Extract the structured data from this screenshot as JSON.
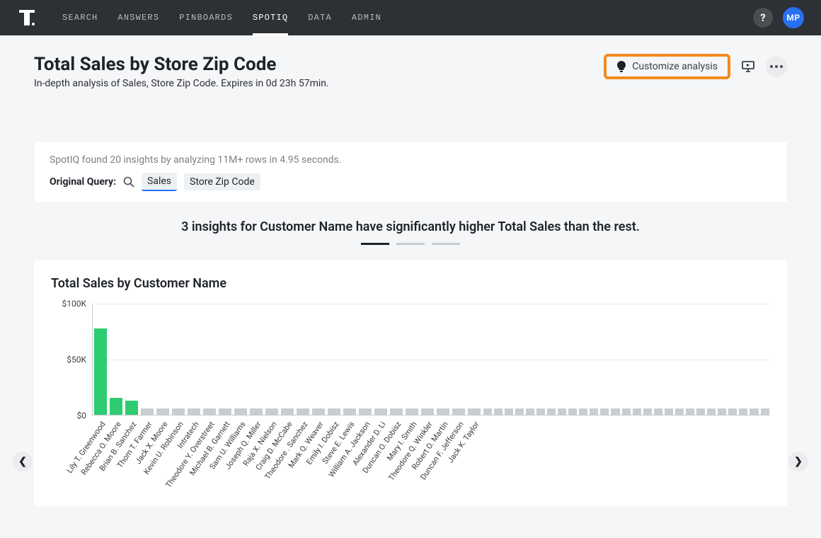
{
  "nav": {
    "items": [
      "SEARCH",
      "ANSWERS",
      "PINBOARDS",
      "SPOTIQ",
      "DATA",
      "ADMIN"
    ],
    "active_index": 3,
    "avatar": "MP",
    "help": "?"
  },
  "header": {
    "title": "Total Sales by Store Zip Code",
    "subtitle": "In-depth analysis of Sales, Store Zip Code. Expires in 0d 23h 57min.",
    "customize_label": "Customize analysis"
  },
  "summary": {
    "text": "SpotIQ found 20 insights by analyzing 11M+ rows in 4.95 seconds.",
    "query_label": "Original Query:",
    "chips": [
      "Sales",
      "Store Zip Code"
    ]
  },
  "insight": {
    "heading": "3 insights for Customer Name have significantly higher Total Sales than the rest.",
    "pager_count": 3,
    "pager_active": 0
  },
  "chart_data": {
    "type": "bar",
    "title": "Total Sales by Customer Name",
    "ylabel": "",
    "ylim": [
      0,
      100000
    ],
    "y_ticks": [
      0,
      50000,
      100000
    ],
    "y_tick_labels": [
      "$0",
      "$50K",
      "$100K"
    ],
    "highlight_count": 3,
    "labeled": [
      {
        "name": "Lily T. Greenwood",
        "value": 78000,
        "highlight": true
      },
      {
        "name": "Rebecca O. Moore",
        "value": 15000,
        "highlight": true
      },
      {
        "name": "Brian B. Sanchez",
        "value": 13000,
        "highlight": true
      },
      {
        "name": "Thom T. Farmer",
        "value": 6000
      },
      {
        "name": "Jack X. Moore",
        "value": 6000
      },
      {
        "name": "Kevin U. Robinson",
        "value": 6000
      },
      {
        "name": "Intratech",
        "value": 6000
      },
      {
        "name": "Theodore Y. Overstreet",
        "value": 6000
      },
      {
        "name": "Michael B. Garnett",
        "value": 6000
      },
      {
        "name": "Sam U. Williams",
        "value": 6000
      },
      {
        "name": "Joseph Q. Miller",
        "value": 6000
      },
      {
        "name": "Raja X. Nielson",
        "value": 6000
      },
      {
        "name": "Craig D. McCabe",
        "value": 6000
      },
      {
        "name": "Theodore . Sanchez",
        "value": 6000
      },
      {
        "name": "Mark Q. Weaver",
        "value": 6000
      },
      {
        "name": "Emily I. Dobisz",
        "value": 6000
      },
      {
        "name": "Steve E. Lewis",
        "value": 6000
      },
      {
        "name": "William A. Jackson",
        "value": 6000
      },
      {
        "name": "Alexander D. Li",
        "value": 6000
      },
      {
        "name": "Duncan O. Dobisz",
        "value": 6000
      },
      {
        "name": "Mary I. Smith",
        "value": 6000
      },
      {
        "name": "Theodore Q. Winkler",
        "value": 6000
      },
      {
        "name": "Robert O. Martin",
        "value": 6000
      },
      {
        "name": "Duncan F. Jefferson",
        "value": 6000
      },
      {
        "name": "Jack K. Taylor",
        "value": 6000
      }
    ],
    "unlabeled_tail_values": [
      6000,
      6000,
      6000,
      6000,
      6000,
      6000,
      6000,
      6000,
      6000,
      6000,
      6000,
      6000,
      6000,
      6000,
      6000,
      6000,
      6000,
      6000,
      6000,
      6000,
      6000,
      6000,
      6000,
      6000,
      6000,
      6000,
      6000
    ]
  },
  "colors": {
    "highlight_bar": "#2ecc71",
    "accent": "#2770ef",
    "callout": "#f38b1e"
  }
}
